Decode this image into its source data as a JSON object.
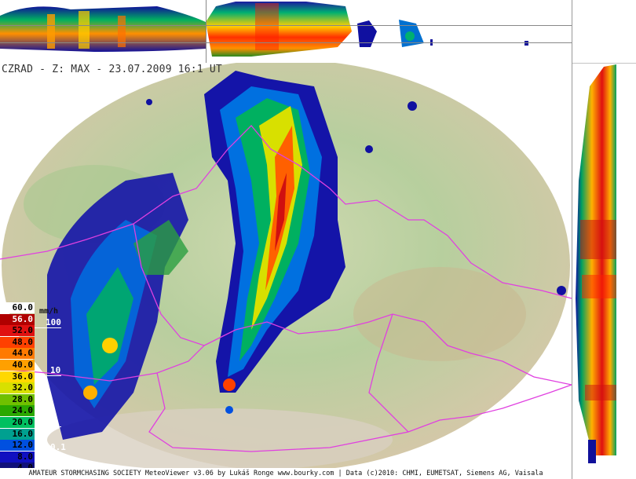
{
  "title": "CZRAD - Z: MAX - 23.07.2009 16:1",
  "title_suffix": "UT",
  "legend": {
    "units": "mm/h",
    "items": [
      {
        "label": "60.0",
        "color": "#ffffff",
        "text": "#000000"
      },
      {
        "label": "56.0",
        "color": "#b00000",
        "text": "#ffffff"
      },
      {
        "label": "52.0",
        "color": "#e01010",
        "text": "#000000"
      },
      {
        "label": "48.0",
        "color": "#ff4000",
        "text": "#000000"
      },
      {
        "label": "44.0",
        "color": "#ff7a00",
        "text": "#000000"
      },
      {
        "label": "40.0",
        "color": "#ffa000",
        "text": "#000000"
      },
      {
        "label": "36.0",
        "color": "#ffd800",
        "text": "#000000"
      },
      {
        "label": "32.0",
        "color": "#d8e000",
        "text": "#000000"
      },
      {
        "label": "28.0",
        "color": "#70c000",
        "text": "#000000"
      },
      {
        "label": "24.0",
        "color": "#2aa800",
        "text": "#000000"
      },
      {
        "label": "20.0",
        "color": "#00c060",
        "text": "#000000"
      },
      {
        "label": "16.0",
        "color": "#00a090",
        "text": "#000000"
      },
      {
        "label": "12.0",
        "color": "#0050e0",
        "text": "#000000"
      },
      {
        "label": "8.0",
        "color": "#1010c0",
        "text": "#000000"
      },
      {
        "label": "4.0",
        "color": "#10107a",
        "text": "#000000"
      }
    ],
    "rain_marks": [
      "100",
      "10",
      "1",
      "0.1"
    ]
  },
  "footer": "AMATEUR STORMCHASING SOCIETY MeteoViewer v3.06 by Lukáš Ronge www.bourky.com | Data (c)2010: CHMI, EUMETSAT, Siemens AG, Vaisala",
  "colors": {
    "border": "#e040e0",
    "terrain_low": "#9cc890",
    "terrain_high": "#d8c6a4"
  }
}
